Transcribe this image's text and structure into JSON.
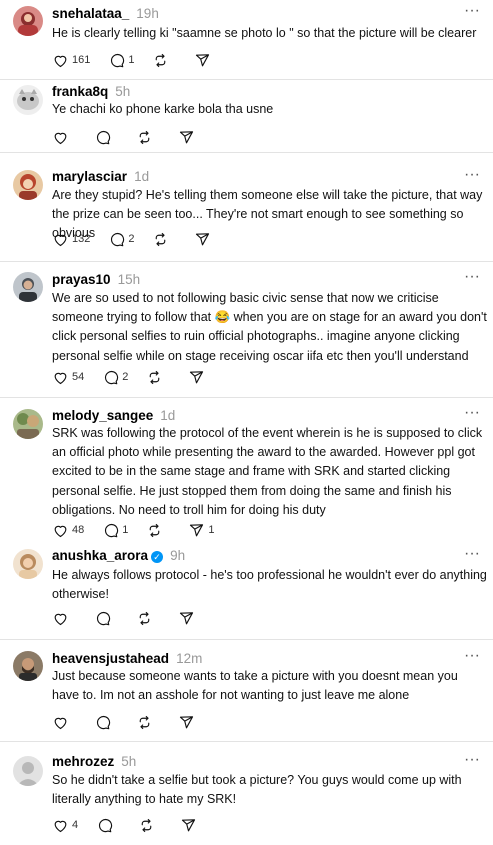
{
  "posts": [
    {
      "username": "snehalataa_",
      "time": "19h",
      "verified": false,
      "text": "He is clearly telling ki \"saamne se photo lo \" so that the picture will be clearer",
      "counts": {
        "like": "161",
        "reply": "1",
        "repost": "",
        "share": ""
      },
      "avatar_color": "#b23a3a"
    },
    {
      "username": "franka8q",
      "time": "5h",
      "verified": false,
      "text": "Ye chachi ko phone karke bola tha usne",
      "counts": {
        "like": "",
        "reply": "",
        "repost": "",
        "share": ""
      },
      "avatar_color": "#d9d9d9"
    },
    {
      "username": "marylasciar",
      "time": "1d",
      "verified": false,
      "text": "Are they stupid? He's telling them someone else will take the picture, that way the prize can be seen too... They're not smart enough to see something so obvious",
      "counts": {
        "like": "132",
        "reply": "2",
        "repost": "",
        "share": ""
      },
      "avatar_color": "#c65d3b"
    },
    {
      "username": "prayas10",
      "time": "15h",
      "verified": false,
      "text": "We are so used to not following basic civic sense that now we criticise someone trying to follow that 😂 when you are on stage for an award you don't click personal selfies to ruin official photographs.. imagine anyone clicking personal selfie while on stage receiving oscar iifa etc then you'll understand",
      "counts": {
        "like": "54",
        "reply": "2",
        "repost": "",
        "share": ""
      },
      "avatar_color": "#6d7680"
    },
    {
      "username": "melody_sangee",
      "time": "1d",
      "verified": false,
      "text": "SRK was following the protocol of the event wherein is he is supposed to click an official photo while presenting the award to the awarded. However ppl got excited to be in the same stage and frame with SRK and started clicking personal selfie. He just stopped them from doing the same and finish his obligations. No need to troll him for doing his duty",
      "counts": {
        "like": "48",
        "reply": "1",
        "repost": "",
        "share": "1"
      },
      "avatar_color": "#8aa36a"
    },
    {
      "username": "anushka_arora",
      "time": "9h",
      "verified": true,
      "text": "He always follows protocol - he's too professional he wouldn't ever do anything otherwise!",
      "counts": {
        "like": "",
        "reply": "",
        "repost": "",
        "share": ""
      },
      "avatar_color": "#d8b48a"
    },
    {
      "username": "heavensjustahead",
      "time": "12m",
      "verified": false,
      "text": "Just because someone wants to take a picture with you doesnt mean you have to. Im not an asshole for not wanting to just leave me alone",
      "counts": {
        "like": "",
        "reply": "",
        "repost": "",
        "share": ""
      },
      "avatar_color": "#5b4636"
    },
    {
      "username": "mehrozez",
      "time": "5h",
      "verified": false,
      "text": "So he didn't take a selfie but took a picture? You guys would come up with literally anything to hate my SRK!",
      "counts": {
        "like": "4",
        "reply": "",
        "repost": "",
        "share": ""
      },
      "avatar_color": "#d6d6d6"
    }
  ],
  "icons": {
    "like": "heart-icon",
    "reply": "comment-icon",
    "repost": "repost-icon",
    "share": "share-icon",
    "more": "more-options-icon"
  }
}
